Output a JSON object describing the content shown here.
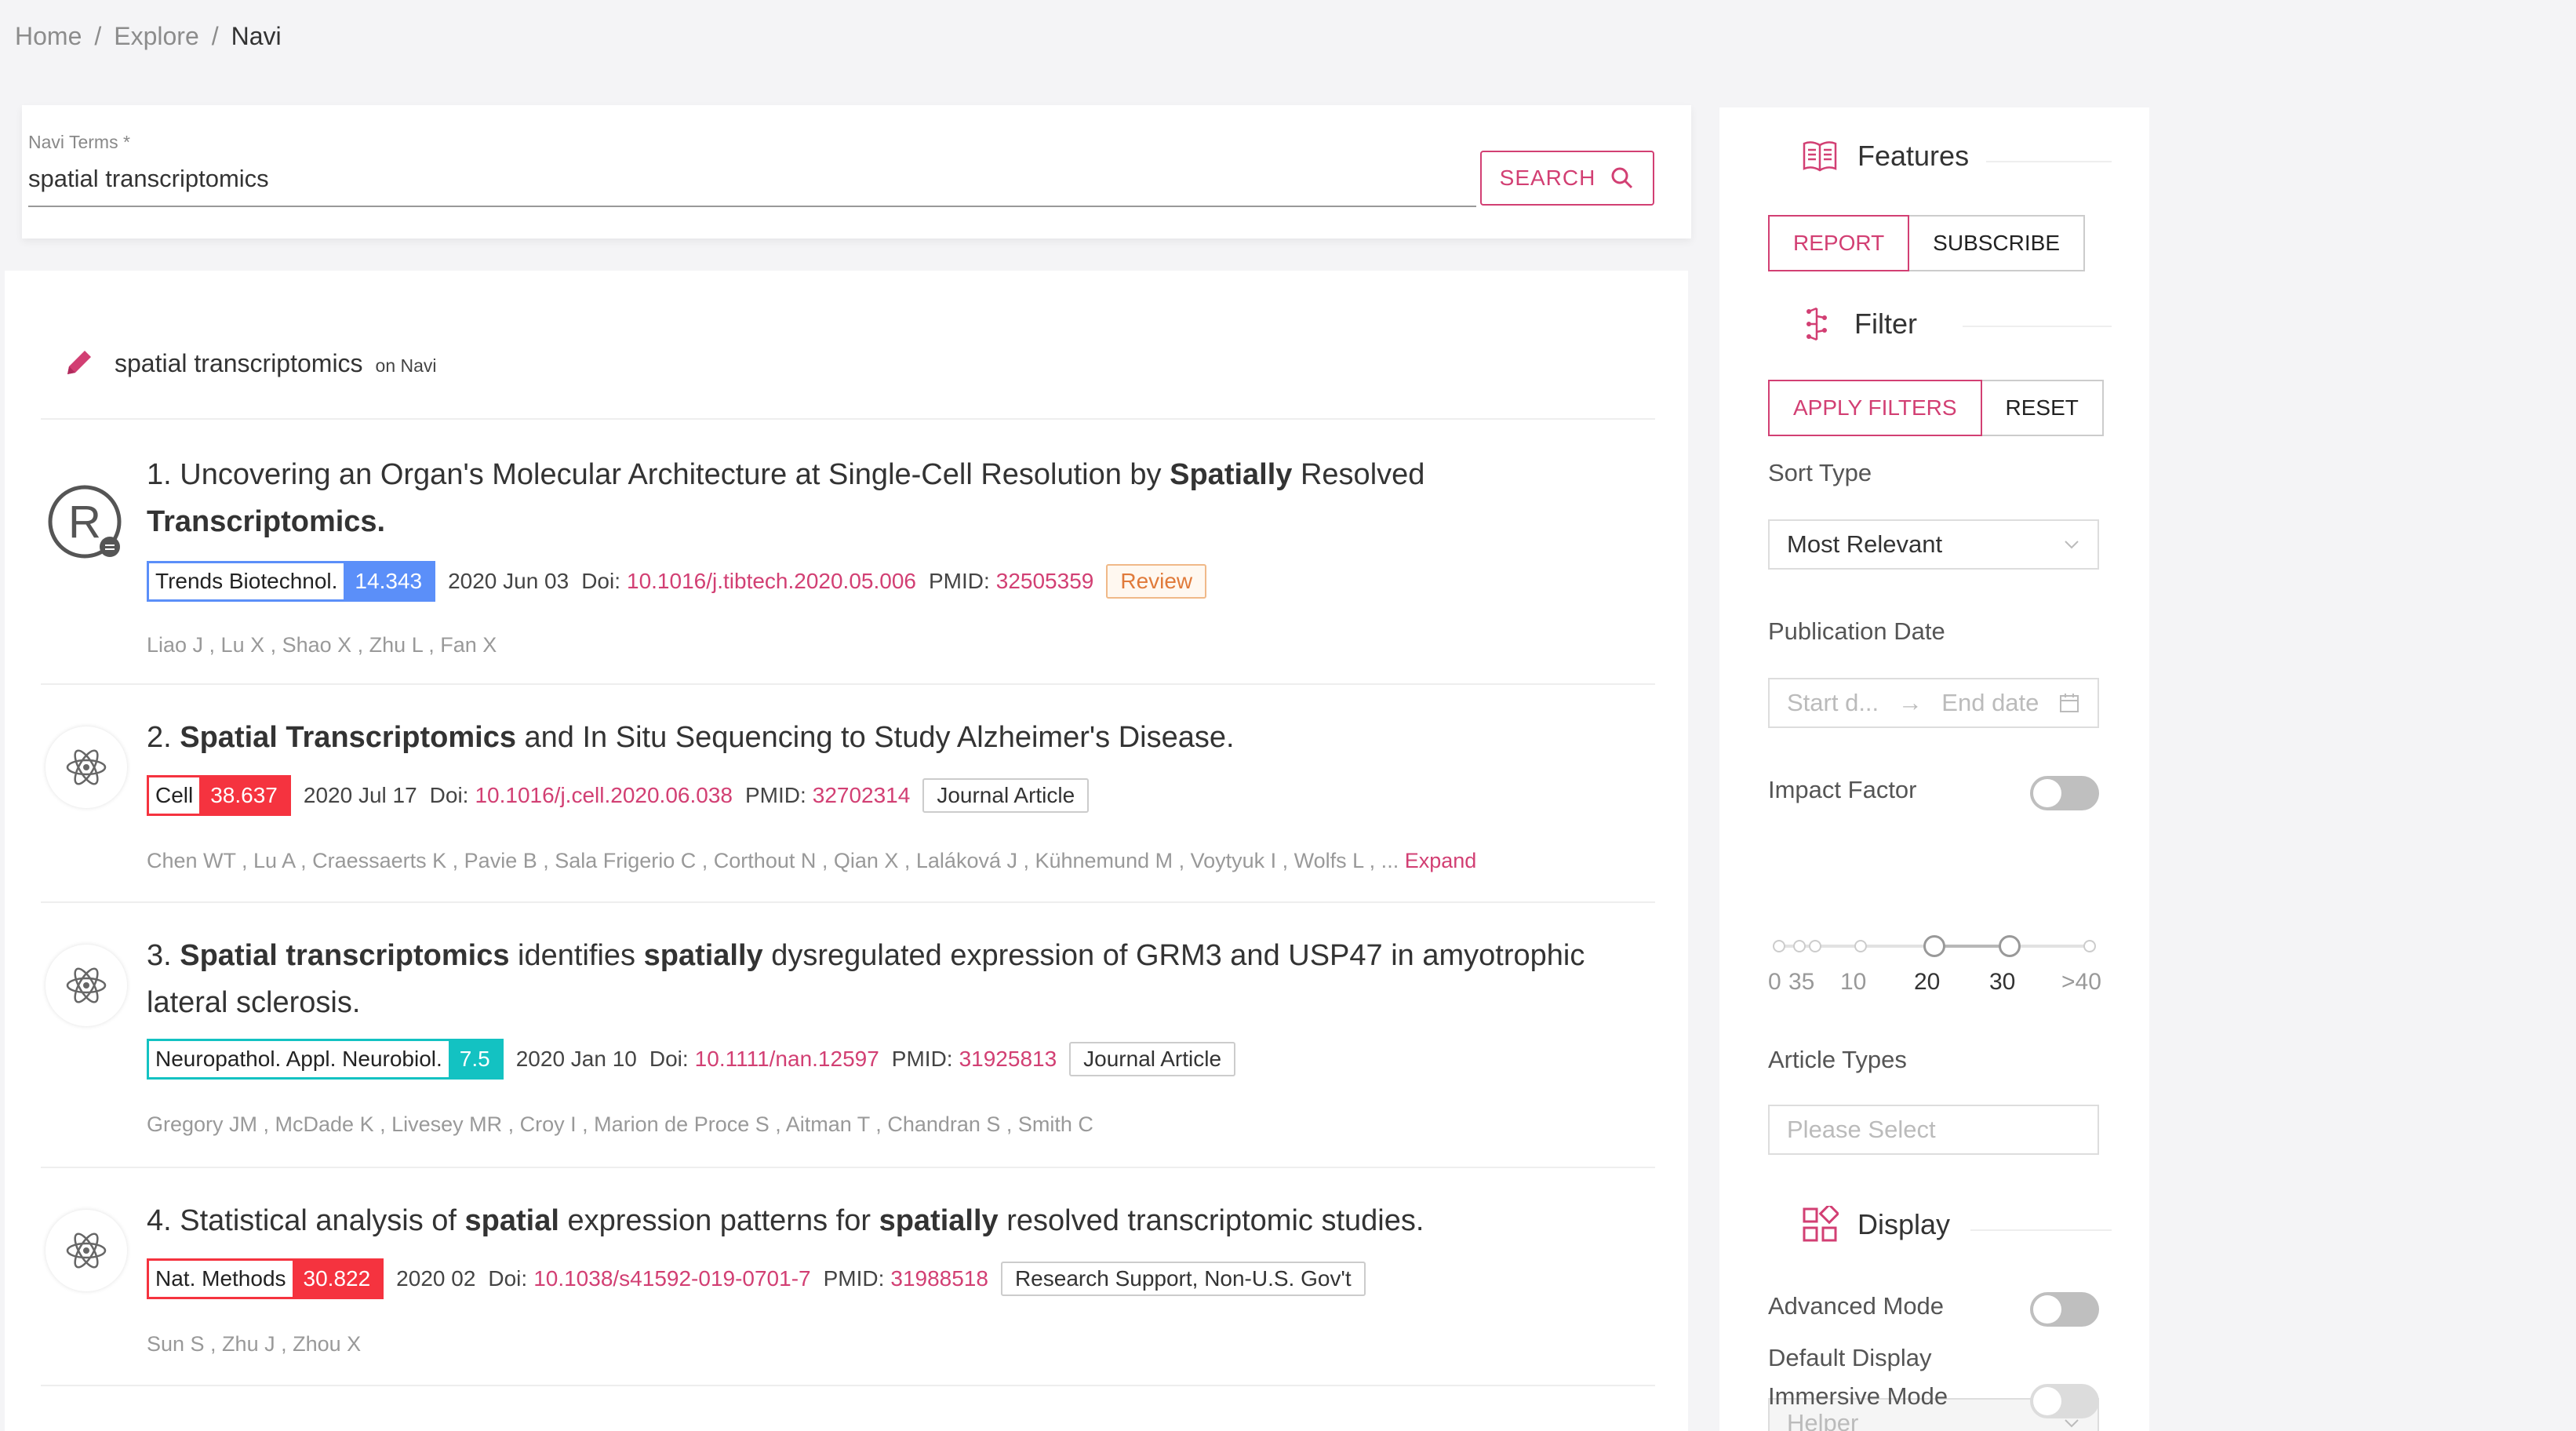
{
  "breadcrumb": {
    "home": "Home",
    "explore": "Explore",
    "current": "Navi"
  },
  "search": {
    "label": "Navi Terms *",
    "value": "spatial transcriptomics",
    "button_label": "SEARCH"
  },
  "query": {
    "term": "spatial transcriptomics",
    "suffix": "on Navi"
  },
  "results": [
    {
      "title_parts": [
        "1. Uncovering an Organ's Molecular Architecture at Single-Cell Resolution by ",
        "Spatially",
        " Resolved ",
        "Transcriptomics."
      ],
      "journal": "Trends Biotechnol.",
      "impact": "14.343",
      "journal_color": "#5b8ff9",
      "date": "2020 Jun 03",
      "doi_label": "Doi:",
      "doi": "10.1016/j.tibtech.2020.05.006",
      "pmid_label": "PMID:",
      "pmid": "32505359",
      "type": "Review",
      "authors": "Liao J , Lu X , Shao X , Zhu L , Fan X"
    },
    {
      "title_parts": [
        "2. ",
        "Spatial Transcriptomics",
        " and In Situ Sequencing to Study Alzheimer's Disease."
      ],
      "journal": "Cell",
      "impact": "38.637",
      "journal_color": "#f5333f",
      "date": "2020 Jul 17",
      "doi_label": "Doi:",
      "doi": "10.1016/j.cell.2020.06.038",
      "pmid_label": "PMID:",
      "pmid": "32702314",
      "type": "Journal Article",
      "authors": "Chen WT , Lu A , Craessaerts K , Pavie B , Sala Frigerio C , Corthout N , Qian X , Laláková J , Kühnemund M , Voytyuk I , Wolfs L , ...",
      "expand": "Expand"
    },
    {
      "title_parts": [
        "3. ",
        "Spatial transcriptomics",
        " identifies ",
        "spatially",
        " dysregulated expression of GRM3 and USP47 in amyotrophic lateral sclerosis."
      ],
      "journal": "Neuropathol. Appl. Neurobiol.",
      "impact": "7.5",
      "journal_color": "#13c2c2",
      "date": "2020 Jan 10",
      "doi_label": "Doi:",
      "doi": "10.1111/nan.12597",
      "pmid_label": "PMID:",
      "pmid": "31925813",
      "type": "Journal Article",
      "authors": "Gregory JM , McDade K , Livesey MR , Croy I , Marion de Proce S , Aitman T , Chandran S , Smith C"
    },
    {
      "title_parts": [
        "4. Statistical analysis of ",
        "spatial",
        " expression patterns for ",
        "spatially",
        " resolved transcriptomic studies."
      ],
      "journal": "Nat. Methods",
      "impact": "30.822",
      "journal_color": "#f5333f",
      "date": "2020 02",
      "doi_label": "Doi:",
      "doi": "10.1038/s41592-019-0701-7",
      "pmid_label": "PMID:",
      "pmid": "31988518",
      "type": "Research Support, Non-U.S. Gov't",
      "authors": "Sun S , Zhu J , Zhou X"
    }
  ],
  "sidebar": {
    "features": {
      "title": "Features",
      "report": "REPORT",
      "subscribe": "SUBSCRIBE"
    },
    "filter": {
      "title": "Filter",
      "apply": "APPLY FILTERS",
      "reset": "RESET"
    },
    "sort": {
      "label": "Sort Type",
      "value": "Most Relevant"
    },
    "pubdate": {
      "label": "Publication Date",
      "start": "Start d...",
      "end": "End date"
    },
    "impact": {
      "label": "Impact Factor",
      "marks": [
        "0",
        "35",
        "10",
        "20",
        "30",
        ">40"
      ],
      "range": [
        20,
        30
      ]
    },
    "article_types": {
      "label": "Article Types",
      "placeholder": "Please Select"
    },
    "display": {
      "title": "Display",
      "advanced": "Advanced Mode",
      "default_display": "Default Display",
      "default_value": "Helper",
      "immersive": "Immersive Mode"
    }
  },
  "colors": {
    "accent": "#d23f73"
  }
}
